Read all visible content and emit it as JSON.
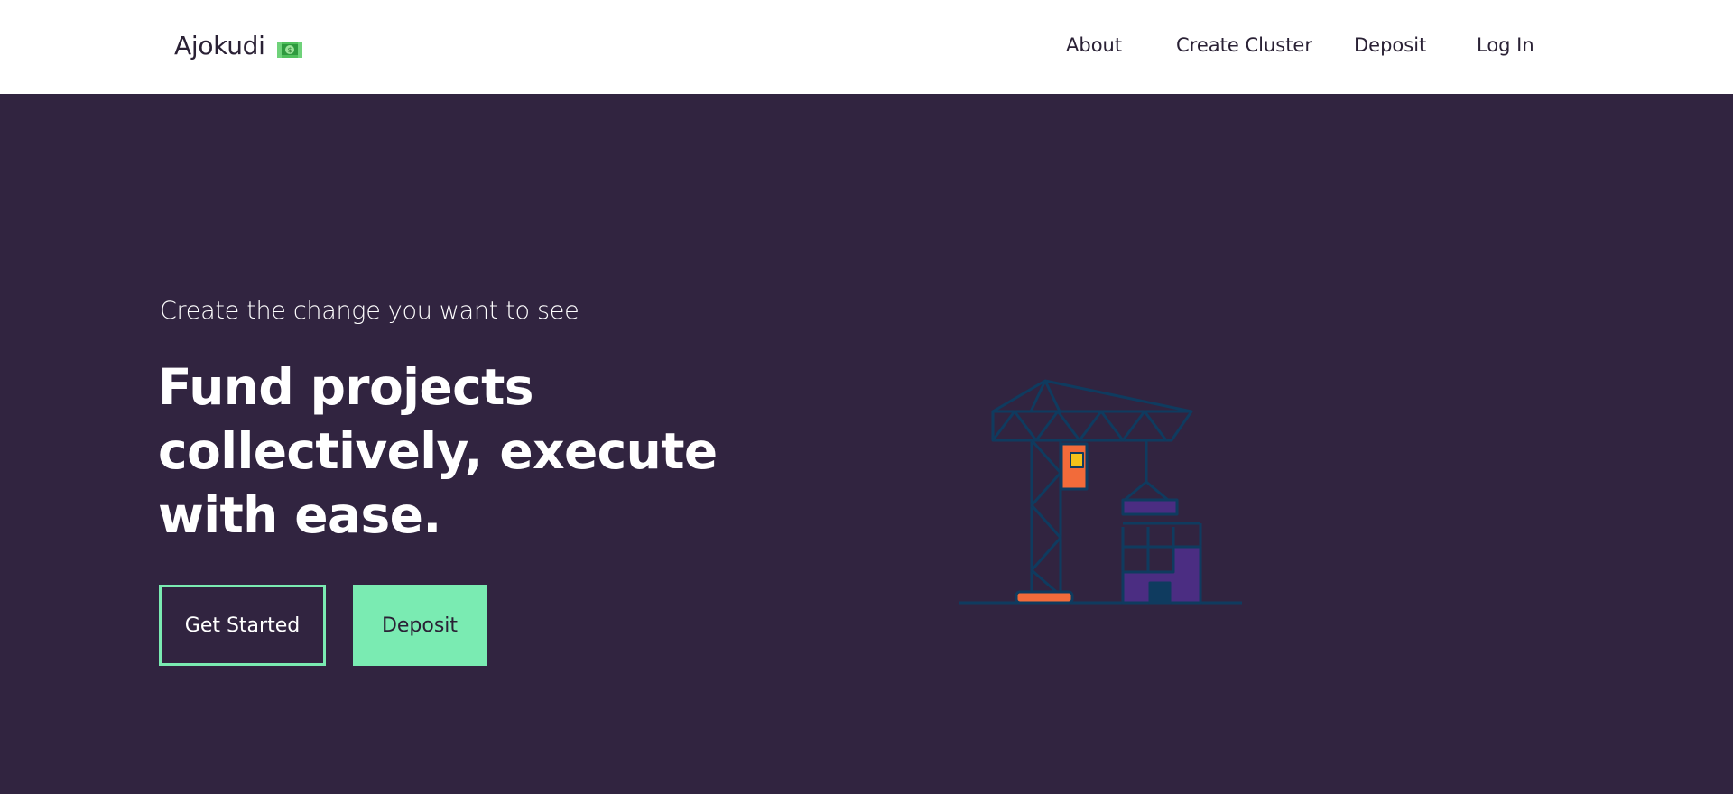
{
  "app": {
    "brand_name": "Ajokudi",
    "brand_icon": "money-banknote-icon"
  },
  "nav": {
    "items": [
      {
        "label": "About"
      },
      {
        "label": "Create Cluster"
      },
      {
        "label": "Deposit"
      },
      {
        "label": "Log In"
      }
    ]
  },
  "hero": {
    "eyebrow": "Create the change you want to see",
    "headline": "Fund projects collectively, execute with ease.",
    "buttons": {
      "get_started": "Get Started",
      "deposit": "Deposit"
    },
    "illustration": "construction-crane-icon"
  },
  "colors": {
    "background": "#312440",
    "navbar": "#ffffff",
    "accent": "#7aebb2",
    "text_dark": "#2a2135",
    "crane_stroke": "#0f3b5f",
    "crane_orange": "#f26b3a",
    "crane_yellow": "#f5c21a",
    "building_purple": "#4b2d82"
  }
}
